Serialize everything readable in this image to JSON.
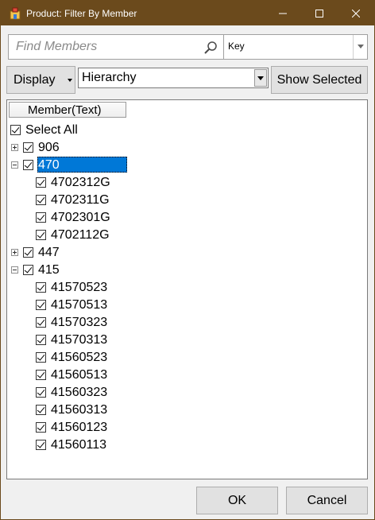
{
  "window": {
    "title": "Product: Filter By Member",
    "controls": {
      "minimize": "—",
      "maximize": "☐",
      "close": "✕"
    },
    "title_bar_color": "#6b4a1c"
  },
  "search": {
    "placeholder": "Find Members",
    "value": "",
    "icon": "search-icon",
    "key_dropdown": {
      "selected": "Key"
    }
  },
  "display": {
    "button_label": "Display",
    "hierarchy_dropdown": {
      "selected": "Hierarchy"
    },
    "show_selected_label": "Show Selected"
  },
  "tree": {
    "column_header": "Member(Text)",
    "select_all": {
      "label": "Select All",
      "checked": true
    },
    "selection_color": "#0078d7",
    "nodes": [
      {
        "label": "906",
        "checked": true,
        "expanded": false,
        "level": 0
      },
      {
        "label": "470",
        "checked": true,
        "expanded": true,
        "level": 0,
        "selected": true
      },
      {
        "label": "4702312G",
        "checked": true,
        "level": 1
      },
      {
        "label": "4702311G",
        "checked": true,
        "level": 1
      },
      {
        "label": "4702301G",
        "checked": true,
        "level": 1
      },
      {
        "label": "4702112G",
        "checked": true,
        "level": 1
      },
      {
        "label": "447",
        "checked": true,
        "expanded": false,
        "level": 0
      },
      {
        "label": "415",
        "checked": true,
        "expanded": true,
        "level": 0
      },
      {
        "label": "41570523",
        "checked": true,
        "level": 1
      },
      {
        "label": "41570513",
        "checked": true,
        "level": 1
      },
      {
        "label": "41570323",
        "checked": true,
        "level": 1
      },
      {
        "label": "41570313",
        "checked": true,
        "level": 1
      },
      {
        "label": "41560523",
        "checked": true,
        "level": 1
      },
      {
        "label": "41560513",
        "checked": true,
        "level": 1
      },
      {
        "label": "41560323",
        "checked": true,
        "level": 1
      },
      {
        "label": "41560313",
        "checked": true,
        "level": 1
      },
      {
        "label": "41560123",
        "checked": true,
        "level": 1
      },
      {
        "label": "41560113",
        "checked": true,
        "level": 1
      }
    ]
  },
  "footer": {
    "ok_label": "OK",
    "cancel_label": "Cancel"
  }
}
